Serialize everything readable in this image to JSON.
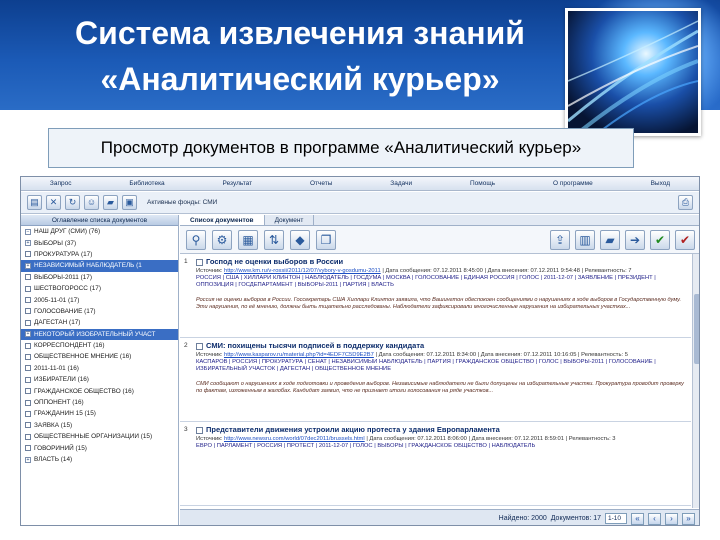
{
  "slide": {
    "title_line1": "Система извлечения знаний",
    "title_line2": "«Аналитический курьер»",
    "subtitle": "Просмотр документов в программе «Аналитический курьер»"
  },
  "colors": {
    "header_bg": "#1b5ab6",
    "selection": "#3a6ec4",
    "link": "#1d4fc4"
  },
  "app": {
    "menu": [
      "Запрос",
      "Библиотека",
      "Результат",
      "Отчеты",
      "Задачи",
      "Помощь",
      "О программе",
      "Выход"
    ],
    "fund_label": "Активные фонды: СМИ",
    "left_tab": "Оглавление списка документов",
    "tree": [
      {
        "label": "НАШ ДРУГ (СМИ) (76)",
        "toggle": "−",
        "selected": false
      },
      {
        "label": "ВЫБОРЫ (37)",
        "toggle": "+",
        "selected": false
      },
      {
        "label": "ПРОКУРАТУРА (17)",
        "toggle": "",
        "selected": false
      },
      {
        "label": "НЕЗАВИСИМЫЙ НАБЛЮДАТЕЛЬ (1",
        "toggle": "+",
        "selected": true
      },
      {
        "label": "ВЫБОРЫ-2011 (17)",
        "toggle": "",
        "selected": false
      },
      {
        "label": "ШЕСТВОГОРОСС (17)",
        "toggle": "",
        "selected": false
      },
      {
        "label": "2005-11-01 (17)",
        "toggle": "",
        "selected": false
      },
      {
        "label": "ГОЛОСОВАНИЕ (17)",
        "toggle": "",
        "selected": false
      },
      {
        "label": "ДАГЕСТАН (17)",
        "toggle": "",
        "selected": false
      },
      {
        "label": "НЕКОТОРЫЙ ИЗОБРАТЕЛЬНЫЙ УЧАСТ",
        "toggle": "+",
        "selected": true
      },
      {
        "label": "КОРРЕСПОНДЕНТ (16)",
        "toggle": "",
        "selected": false
      },
      {
        "label": "ОБЩЕСТВЕННОЕ МНЕНИЕ (16)",
        "toggle": "",
        "selected": false
      },
      {
        "label": "2011-11-01 (16)",
        "toggle": "",
        "selected": false
      },
      {
        "label": "ИЗБИРАТЕЛИ (16)",
        "toggle": "",
        "selected": false
      },
      {
        "label": "ГРАЖДАНСКОЕ ОБЩЕСТВО (16)",
        "toggle": "",
        "selected": false
      },
      {
        "label": "ОППОНЕНТ (16)",
        "toggle": "",
        "selected": false
      },
      {
        "label": "ГРАЖДАНИН 15 (15)",
        "toggle": "",
        "selected": false
      },
      {
        "label": "ЗАЯВКА (15)",
        "toggle": "",
        "selected": false
      },
      {
        "label": "ОБЩЕСТВЕННЫЕ ОРГАНИЗАЦИИ (15)",
        "toggle": "",
        "selected": false
      },
      {
        "label": "ГОВОРИНИЙ (15)",
        "toggle": "",
        "selected": false
      },
      {
        "label": "ВЛАСТЬ (14)",
        "toggle": "+",
        "selected": false
      }
    ],
    "tabs": [
      "Список документов",
      "Документ"
    ],
    "documents": [
      {
        "num": "1",
        "title": "Господ не оценки выборов в России",
        "meta_prefix": "Источник:",
        "meta_link": "http://www.km.ru/v-rossii/2011/12/07/vybory-v-gosdumu-2011",
        "meta_suffix": "| Дата сообщения: 07.12.2011 8:45:00 | Дата внесения: 07.12.2011 9:54:48 | Релевантность: 7",
        "tags": "РОССИЯ | США | ХИЛЛАРИ КЛИНТОН | НАБЛЮДАТЕЛЬ | ГОСДУМА | МОСКВА | ГОЛОСОВАНИЕ | ЕДИНАЯ РОССИЯ | ГОЛОС | 2011-12-07 | ЗАЯВЛЕНИЕ | ПРЕЗИДЕНТ | ОППОЗИЦИЯ | ГОСДЕПАРТАМЕНТ | ВЫБОРЫ-2011 | ПАРТИЯ | ВЛАСТЬ",
        "abstract": "Россия не оценки выборов в России. Госсекретарь США Хиллари Клинтон заявила, что Вашингтон обеспокоен сообщениями о нарушениях в ходе выборов в Государственную думу. Эти нарушения, по её мнению, должны быть тщательно расследованы. Наблюдатели зафиксировали многочисленные нарушения на избирательных участках..."
      },
      {
        "num": "2",
        "title": "СМИ: похищены тысячи подписей в поддержку кандидата",
        "meta_prefix": "Источник:",
        "meta_link": "http://www.kasparov.ru/material.php?id=4EDF7C5D9E2B7",
        "meta_suffix": "| Дата сообщения: 07.12.2011 8:34:00 | Дата внесения: 07.12.2011 10:16:05 | Релевантность: 5",
        "tags": "КАСПАРОВ | РОССИЯ | ПРОКУРАТУРА | СЕНАТ | НЕЗАВИСИМЫЙ НАБЛЮДАТЕЛЬ | ПАРТИЯ | ГРАЖДАНСКОЕ ОБЩЕСТВО | ГОЛОС | ВЫБОРЫ-2011 | ГОЛОСОВАНИЕ | ИЗБИРАТЕЛЬНЫЙ УЧАСТОК | ДАГЕСТАН | ОБЩЕСТВЕННОЕ МНЕНИЕ",
        "abstract": "СМИ сообщают о нарушениях в ходе подготовки и проведения выборов. Независимые наблюдатели не были допущены на избирательные участки. Прокуратура проводит проверку по фактам, изложенным в жалобах. Кандидат заявил, что не признает итоги голосования на ряде участков..."
      },
      {
        "num": "3",
        "title": "Представители движения устроили акцию протеста у здания Европарламента",
        "meta_prefix": "Источник:",
        "meta_link": "http://www.newsru.com/world/07dec2011/brussels.html",
        "meta_suffix": "| Дата сообщения: 07.12.2011 8:06:00 | Дата внесения: 07.12.2011 8:59:01 | Релевантность: 3",
        "tags": "ЕВРО | ПАРЛАМЕНТ | РОССИЯ | ПРОТЕСТ | 2011-12-07 | ГОЛОС | ВЫБОРЫ | ГРАЖДАНСКОЕ ОБЩЕСТВО | НАБЛЮДАТЕЛЬ",
        "abstract": ""
      }
    ],
    "status": {
      "found_label": "Найдено: 2000",
      "docs_label": "Документов: 17",
      "page_value": "1-10"
    }
  }
}
